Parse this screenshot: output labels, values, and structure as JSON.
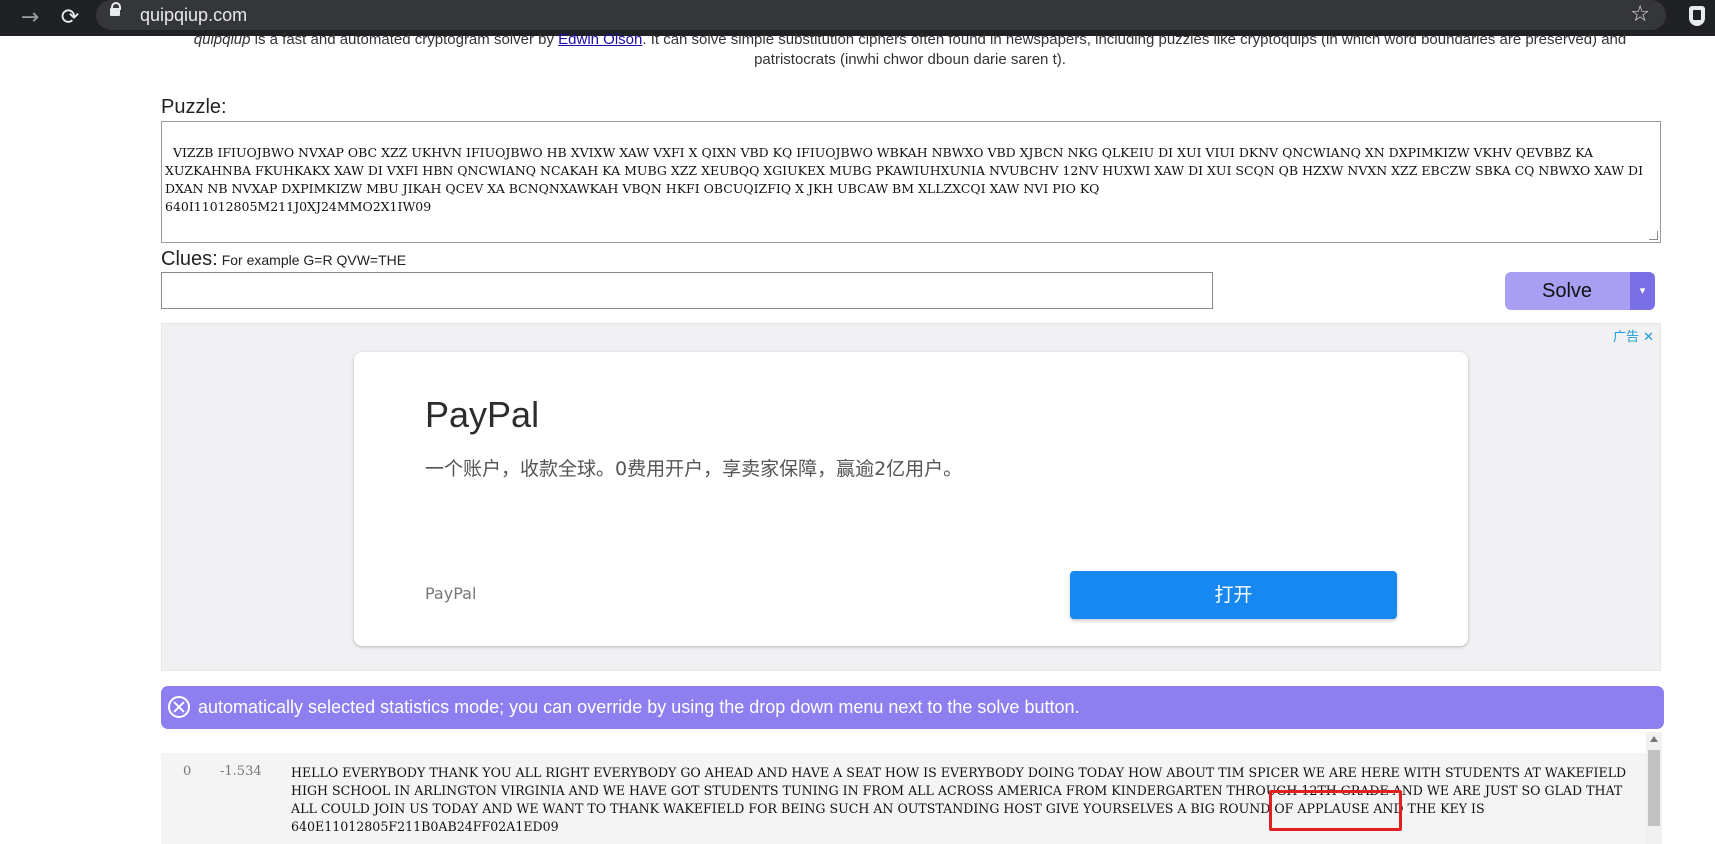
{
  "browser": {
    "url": "quipqiup.com"
  },
  "intro": {
    "site_name": "quipqiup",
    "text_a": " is a fast and automated cryptogram solver by ",
    "author": "Edwin Olson",
    "text_b": ". It can solve simple substitution ciphers often found in newspapers, including puzzles like cryptoquips (in which word boundaries are preserved) and patristocrats (inwhi chwor dboun darie saren t)."
  },
  "puzzle": {
    "label": "Puzzle:",
    "value": "VIZZB IFIUOJBWO NVXAP OBC XZZ UKHVN IFIUOJBWO HB XVIXW XAW VXFI X QIXN VBD KQ IFIUOJBWO WBKAH NBWXO VBD XJBCN NKG QLKEIU DI XUI VIUI DKNV QNCWIANQ XN DXPIMKIZW VKHV QEVBBZ KA XUZKAHNBA FKUHKAKX XAW DI VXFI HBN QNCWIANQ NCAKAH KA MUBG XZZ XEUBQQ XGIUKEX MUBG PKAWIUHXUNIA NVUBCHV 12NV HUXWI XAW DI XUI SCQN QB HZXW NVXN XZZ EBCZW SBKA CQ NBWXO XAW DI DXAN NB NVXAP DXPIMKIZW MBU JIKAH QCEV XA BCNQNXAWKAH VBQN HKFI OBCUQIZFIQ X JKH UBCAW BM XLLZXCQI XAW NVI PIO KQ\n640I11012805M211J0XJ24MMO2X1IW09"
  },
  "clues": {
    "label": "Clues:",
    "hint": "For example G=R QVW=THE",
    "value": ""
  },
  "solve_button": {
    "label": "Solve",
    "dropdown": "▾"
  },
  "ad": {
    "badge": "广告 ✕",
    "title": "PayPal",
    "description": "一个账户，收款全球。0费用开户，享卖家保障，赢逾2亿用户。",
    "brand": "PayPal",
    "open_label": "打开"
  },
  "banner": {
    "message": "automatically selected statistics mode; you can override by using the drop down menu next to the solve button."
  },
  "results": [
    {
      "index": "0",
      "score": "-1.534",
      "solution": "HELLO EVERYBODY THANK YOU ALL RIGHT EVERYBODY GO AHEAD AND HAVE A SEAT HOW IS EVERYBODY DOING TODAY HOW ABOUT TIM SPICER WE ARE HERE WITH STUDENTS AT WAKEFIELD HIGH SCHOOL IN ARLINGTON VIRGINIA AND WE HAVE GOT STUDENTS TUNING IN FROM ALL ACROSS AMERICA FROM KINDERGARTEN THROUGH 12TH GRADE AND WE ARE JUST SO GLAD THAT ALL COULD JOIN US TODAY AND WE WANT TO THANK WAKEFIELD FOR BEING SUCH AN OUTSTANDING HOST GIVE YOURSELVES A BIG ROUND OF APPLAUSE AND THE KEY IS\n640E11012805F211B0AB24FF02A1ED09"
    }
  ],
  "colors": {
    "solve_button": "#a89ef2",
    "banner": "#8d7ff0",
    "ad_button": "#1787f2",
    "highlight_box": "#e02020"
  }
}
